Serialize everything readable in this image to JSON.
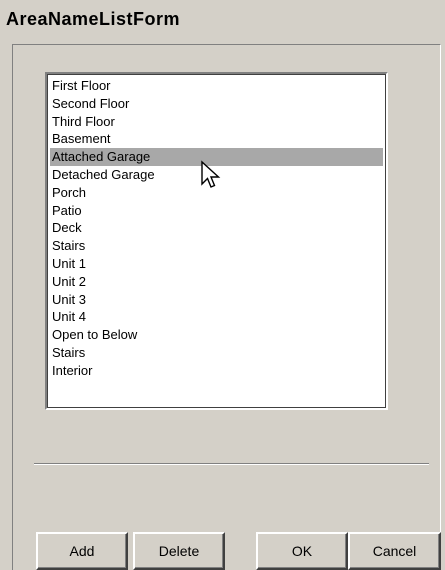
{
  "window": {
    "title": "AreaNameListForm"
  },
  "list": {
    "items": [
      "First Floor",
      "Second Floor",
      "Third Floor",
      "Basement",
      "Attached Garage",
      "Detached Garage",
      "Porch",
      "Patio",
      "Deck",
      "Stairs",
      "Unit 1",
      "Unit 2",
      "Unit 3",
      "Unit 4",
      "Open to Below",
      "Stairs",
      "Interior"
    ],
    "selected_index": 4
  },
  "buttons": {
    "add": "Add",
    "delete": "Delete",
    "ok": "OK",
    "cancel": "Cancel"
  },
  "colors": {
    "dialog_bg": "#d4d0c8",
    "selection": "#a8a8a8"
  }
}
